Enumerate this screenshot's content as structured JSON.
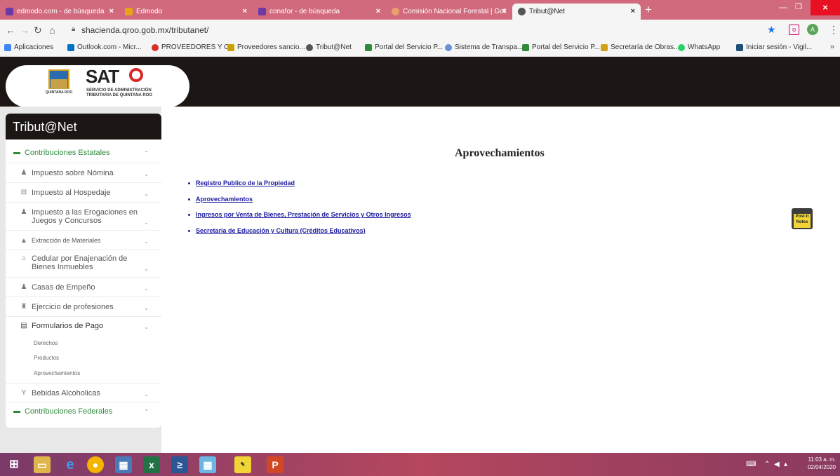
{
  "browser": {
    "tabs": [
      {
        "label": "edmodo.com - de búsqueda",
        "fav_color": "#6c3aa5"
      },
      {
        "label": "Edmodo",
        "fav_color": "#e8a317"
      },
      {
        "label": "conafor - de búsqueda",
        "fav_color": "#6c3aa5"
      },
      {
        "label": "Comisión Nacional Forestal | Gol",
        "fav_color": "#e9a06d"
      },
      {
        "label": "Tribut@Net",
        "fav_color": "#555555"
      }
    ],
    "url": "shacienda.qroo.gob.mx/tributanet/",
    "profile_initial": "A",
    "ext_label": "ʊ",
    "bookmarks": [
      {
        "label": "Aplicaciones",
        "color": "#4285f4"
      },
      {
        "label": "Outlook.com - Micr...",
        "color": "#0072c6"
      },
      {
        "label": "PROVEEDORES Y C...",
        "color": "#d93025"
      },
      {
        "label": "Proveedores sancio...",
        "color": "#c8a200"
      },
      {
        "label": "Tribut@Net",
        "color": "#555555"
      },
      {
        "label": "Portal del Servicio P...",
        "color": "#2e8b3a"
      },
      {
        "label": "Sistema de Transpa...",
        "color": "#6b8fd6"
      },
      {
        "label": "Portal del Servicio P...",
        "color": "#2e8b3a"
      },
      {
        "label": "Secretaría de Obras...",
        "color": "#d4a017"
      },
      {
        "label": "WhatsApp",
        "color": "#25d366"
      },
      {
        "label": "Iniciar sesión - Vigil...",
        "color": "#1f4e79"
      }
    ],
    "bookmarks_more": "»"
  },
  "header": {
    "logo_title": "SAT",
    "logo_sub1": "SERVICIO DE ADMINISTRACIÓN",
    "logo_sub2": "TRIBUTARIA DE QUINTANA ROO",
    "crest_label": "QUINTANA ROO"
  },
  "sidebar": {
    "title": "Tribut@Net",
    "items": [
      {
        "label": "Contribuciones Estatales",
        "icon": "folder-open-icon",
        "glyph": "▬"
      },
      {
        "label": "Impuesto sobre Nómina",
        "icon": "person-icon",
        "glyph": "♟"
      },
      {
        "label": "Impuesto al Hospedaje",
        "icon": "bed-icon",
        "glyph": "⊟"
      },
      {
        "label": "Impuesto a las Erogaciones en Juegos y Concursos",
        "icon": "person-icon",
        "glyph": "♟"
      },
      {
        "label": "Extracción de Materiales",
        "icon": "mountain-icon",
        "glyph": "▲"
      },
      {
        "label": "Cedular por Enajenación de Bienes Inmuebles",
        "icon": "home-icon",
        "glyph": "⌂"
      },
      {
        "label": "Casas de Empeño",
        "icon": "person-icon",
        "glyph": "♟"
      },
      {
        "label": "Ejercicio de profesiones",
        "icon": "graduation-icon",
        "glyph": "♜"
      },
      {
        "label": "Formularios de Pago",
        "icon": "form-icon",
        "glyph": "▤"
      },
      {
        "label": "Bebidas Alcoholicas",
        "icon": "glass-icon",
        "glyph": "Y"
      },
      {
        "label": "Contribuciones Federales",
        "icon": "folder-open-icon",
        "glyph": "▬"
      }
    ],
    "subitems": [
      "Derechos",
      "Productos",
      "Aprovechamientos"
    ]
  },
  "main": {
    "title": "Aprovechamientos",
    "links": [
      "Registro Publico de la Propiedad",
      "Aprovechamientos",
      "Ingresos por Venta de Bienes, Prestación de Servicios y Otros Ingresos",
      "Secretaria de Educación y Cultura (Créditos Educativos)"
    ],
    "postit_label": "Post-it Notes"
  },
  "taskbar": {
    "time": "11:03 a. m.",
    "date": "02/04/2020"
  }
}
